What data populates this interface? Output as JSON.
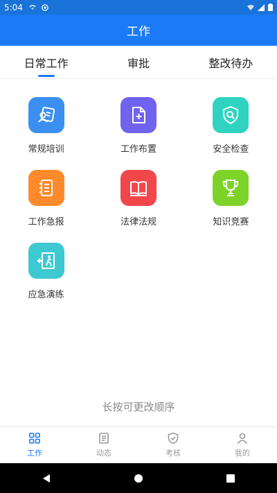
{
  "status_bar": {
    "time": "5:04"
  },
  "title": "工作",
  "tabs": [
    {
      "label": "日常工作",
      "active": true
    },
    {
      "label": "审批",
      "active": false
    },
    {
      "label": "整改待办",
      "active": false
    }
  ],
  "grid_items": [
    {
      "label": "常规培训",
      "icon": "training-icon",
      "color": "#3b8ff0"
    },
    {
      "label": "工作布置",
      "icon": "add-document-icon",
      "color": "#6f63f0"
    },
    {
      "label": "安全检查",
      "icon": "shield-search-icon",
      "color": "#2fd3c0"
    },
    {
      "label": "工作急报",
      "icon": "notebook-icon",
      "color": "#ff8a2b"
    },
    {
      "label": "法律法规",
      "icon": "book-icon",
      "color": "#f2474a"
    },
    {
      "label": "知识竞赛",
      "icon": "trophy-icon",
      "color": "#7ed32b"
    },
    {
      "label": "应急演练",
      "icon": "emergency-exit-icon",
      "color": "#3ec9d2"
    }
  ],
  "hint": "长按可更改顺序",
  "bottom_nav": [
    {
      "label": "工作",
      "icon": "grid-icon",
      "active": true
    },
    {
      "label": "动态",
      "icon": "news-icon",
      "active": false
    },
    {
      "label": "考核",
      "icon": "shield-check-icon",
      "active": false
    },
    {
      "label": "我的",
      "icon": "person-icon",
      "active": false
    }
  ],
  "colors": {
    "primary": "#1a7af8"
  }
}
